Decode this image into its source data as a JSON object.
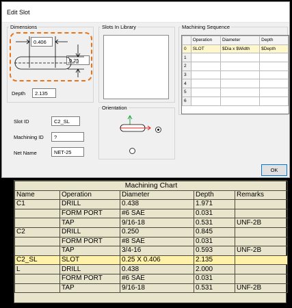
{
  "dialog": {
    "title": "Edit Slot",
    "dimensions": {
      "legend": "Dimensions",
      "width_value": "0.406",
      "height_value": "0.25",
      "depth_label": "Depth",
      "depth_value": "2.135"
    },
    "slot_id_label": "Slot ID",
    "slot_id_value": "C2_SL",
    "machining_id_label": "Machining ID",
    "machining_id_value": "?",
    "net_name_label": "Net Name",
    "net_name_value": "NET-25",
    "slots_in_library": {
      "legend": "Slots In Library"
    },
    "orientation": {
      "legend": "Orientation",
      "horizontal_selected": true
    },
    "sequence": {
      "legend": "Machining Sequence",
      "headers": [
        "Operation",
        "Diameter",
        "Depth"
      ],
      "row_numbers": [
        "0",
        "1",
        "2",
        "3",
        "4",
        "5",
        "6"
      ],
      "rows": [
        {
          "operation": "SLOT",
          "diameter": "$Dia x $Width",
          "depth": "$Depth"
        }
      ]
    },
    "ok_label": "OK",
    "accent_color": "#ea7317"
  },
  "chart": {
    "title": "Machining Chart",
    "headers": [
      "Name",
      "Operation",
      "Diameter",
      "Depth",
      "Remarks"
    ],
    "rows": [
      [
        "C1",
        "DRILL",
        "0.438",
        "1.971",
        ""
      ],
      [
        "",
        "FORM PORT",
        "#6 SAE",
        "0.031",
        ""
      ],
      [
        "",
        "TAP",
        "9/16-18",
        "0.531",
        "UNF-2B"
      ],
      [
        "C2",
        "DRILL",
        "0.250",
        "0.845",
        ""
      ],
      [
        "",
        "FORM PORT",
        "#8 SAE",
        "0.031",
        ""
      ],
      [
        "",
        "TAP",
        "3/4-16",
        "0.593",
        "UNF-2B"
      ],
      [
        "C2_SL",
        "SLOT",
        "0.25 X 0.406",
        "2.135",
        ""
      ],
      [
        "L",
        "DRILL",
        "0.438",
        "2.000",
        ""
      ],
      [
        "",
        "FORM PORT",
        "#6 SAE",
        "0.031",
        ""
      ],
      [
        "",
        "TAP",
        "9/16-18",
        "0.531",
        "UNF-2B"
      ]
    ],
    "highlight_row": 6,
    "background": "#e9e4cc",
    "highlight_color": "#fff2a8"
  }
}
